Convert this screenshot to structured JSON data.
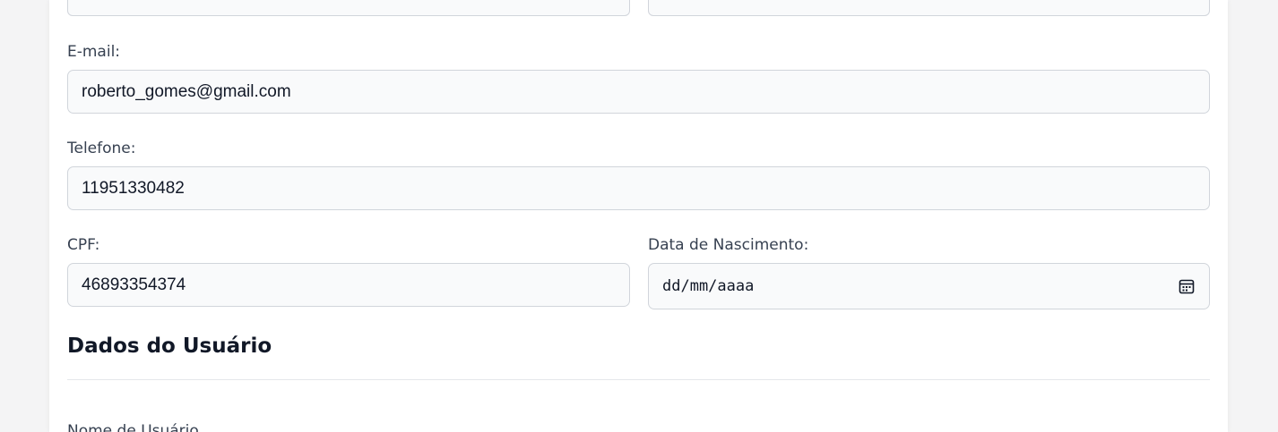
{
  "form": {
    "email": {
      "label": "E-mail:",
      "value": "roberto_gomes@gmail.com"
    },
    "phone": {
      "label": "Telefone:",
      "value": "11951330482"
    },
    "cpf": {
      "label": "CPF:",
      "value": "46893354374"
    },
    "birthdate": {
      "label": "Data de Nascimento:",
      "placeholder": "dd/mm/aaaa"
    }
  },
  "user_section": {
    "title": "Dados do Usuário",
    "username_label": "Nome de Usuário"
  },
  "colors": {
    "input_bg": "#f9fafb",
    "input_border": "#d1d5db",
    "label_text": "#374151",
    "heading_text": "#111827"
  }
}
